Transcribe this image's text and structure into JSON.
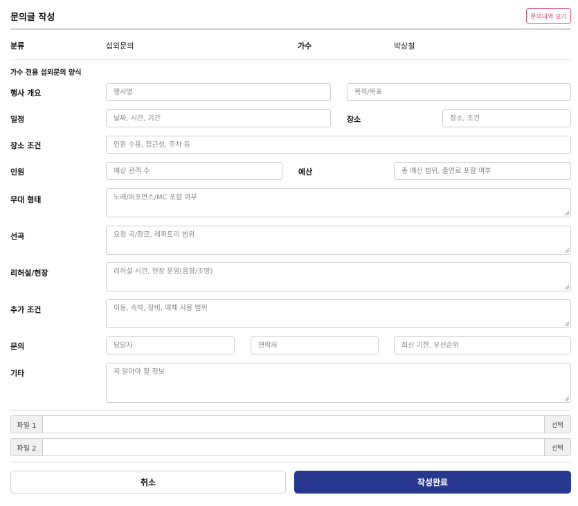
{
  "header": {
    "title": "문의글 작성",
    "history_button": "문의내역 보기"
  },
  "info": {
    "category_label": "분류",
    "category_value": "섭외문의",
    "singer_label": "가수",
    "singer_value": "박상철"
  },
  "form": {
    "section_title": "가수 전용 섭외문의 양식",
    "event_overview": {
      "label": "행사 개요",
      "name_placeholder": "행사명",
      "purpose_placeholder": "목적/목표"
    },
    "schedule": {
      "label": "일정",
      "placeholder": "날짜, 시간, 기간"
    },
    "place": {
      "label": "장소",
      "placeholder": "장소, 조건"
    },
    "place_conditions": {
      "label": "장소 조건",
      "placeholder": "인원 수용, 접근성, 주차 등"
    },
    "headcount": {
      "label": "인원",
      "placeholder": "예상 관객 수"
    },
    "budget": {
      "label": "예산",
      "placeholder": "총 예산 범위, 출연료 포함 여부"
    },
    "stage_type": {
      "label": "무대 형태",
      "placeholder": "노래/퍼포먼스/MC 포함 여부"
    },
    "song_selection": {
      "label": "선곡",
      "placeholder": "요청 곡/장르, 레퍼토리 범위"
    },
    "rehearsal": {
      "label": "리허설/현장",
      "placeholder": "리허설 시간, 현장 운영(음향/조명)"
    },
    "extra_conditions": {
      "label": "추가 조건",
      "placeholder": "이동, 숙박, 장비, 매체 사용 범위"
    },
    "contact": {
      "label": "문의",
      "manager_placeholder": "담당자",
      "phone_placeholder": "연락처",
      "reply_placeholder": "회신 기한, 우선순위"
    },
    "etc": {
      "label": "기타",
      "placeholder": "꼭 알아야 할 정보"
    }
  },
  "files": [
    {
      "label": "파일 1",
      "select": "선택"
    },
    {
      "label": "파일 2",
      "select": "선택"
    }
  ],
  "actions": {
    "cancel": "취소",
    "submit": "작성완료"
  },
  "colors": {
    "accent_pink": "#d94a7c",
    "submit_blue": "#29388f"
  },
  "icons": {
    "resize": "resize-grip-icon"
  }
}
